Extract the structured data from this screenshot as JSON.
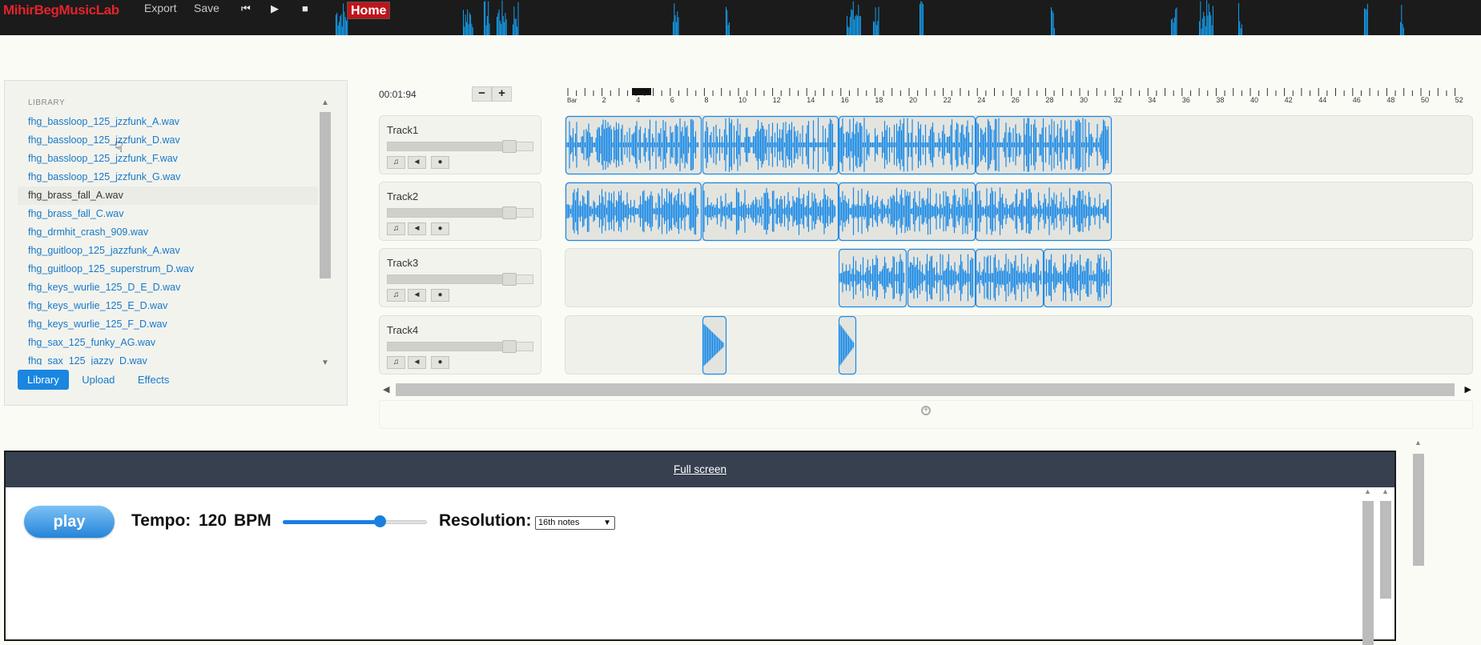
{
  "topbar": {
    "brand": "MihirBegMusicLab",
    "export_label": "Export",
    "save_label": "Save",
    "home_label": "Home",
    "icons": [
      "skip-back-icon",
      "play-icon",
      "stop-icon"
    ]
  },
  "library": {
    "heading": "LIBRARY",
    "items": [
      "fhg_bassloop_125_jzzfunk_A.wav",
      "fhg_bassloop_125_jzzfunk_D.wav",
      "fhg_bassloop_125_jzzfunk_F.wav",
      "fhg_bassloop_125_jzzfunk_G.wav",
      "fhg_brass_fall_A.wav",
      "fhg_brass_fall_C.wav",
      "fhg_drmhit_crash_909.wav",
      "fhg_guitloop_125_jazzfunk_A.wav",
      "fhg_guitloop_125_superstrum_D.wav",
      "fhg_keys_wurlie_125_D_E_D.wav",
      "fhg_keys_wurlie_125_E_D.wav",
      "fhg_keys_wurlie_125_F_D.wav",
      "fhg_sax_125_funky_AG.wav",
      "fhg_sax_125_jazzy_D.wav"
    ],
    "selected_index": 4,
    "tabs": [
      "Library",
      "Upload",
      "Effects"
    ],
    "active_tab": "Library"
  },
  "timeline": {
    "time": "00:01:94",
    "zoom_out": "−",
    "zoom_in": "+",
    "ruler_first_label": "Bar",
    "ruler_labels": [
      "2",
      "4",
      "6",
      "8",
      "10",
      "12",
      "14",
      "16",
      "18",
      "20",
      "22",
      "24",
      "26",
      "28",
      "30",
      "32",
      "34",
      "36",
      "38",
      "40",
      "42",
      "44",
      "46",
      "48",
      "50",
      "52"
    ],
    "clip_color": "#1a8ae6"
  },
  "tracks": [
    {
      "name": "Track1"
    },
    {
      "name": "Track2"
    },
    {
      "name": "Track3"
    },
    {
      "name": "Track4"
    }
  ],
  "track_button_icons": [
    "headphones-icon",
    "mute-icon",
    "record-icon"
  ],
  "sequencer": {
    "fullscreen_label": "Full screen",
    "play_label": "play",
    "tempo_label": "Tempo:",
    "tempo_value": "120",
    "tempo_unit": "BPM",
    "resolution_label": "Resolution:",
    "resolution_value": "16th notes",
    "accent": "#1a7fe0"
  }
}
